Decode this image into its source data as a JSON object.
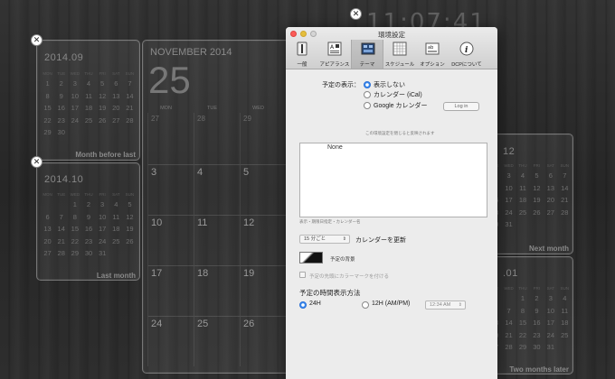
{
  "clock": {
    "time": "11:07:41"
  },
  "prev_month": {
    "title": "2014.09",
    "day_headers": [
      "MON",
      "TUE",
      "WED",
      "THU",
      "FRI",
      "SAT",
      "SUN"
    ],
    "days": [
      "1",
      "2",
      "3",
      "4",
      "5",
      "6",
      "7",
      "8",
      "9",
      "10",
      "11",
      "12",
      "13",
      "14",
      "15",
      "16",
      "17",
      "18",
      "19",
      "20",
      "21",
      "22",
      "23",
      "24",
      "25",
      "26",
      "27",
      "28",
      "29",
      "30"
    ],
    "footer": "Month before last"
  },
  "last_month": {
    "title": "2014.10",
    "day_headers": [
      "MON",
      "TUE",
      "WED",
      "THU",
      "FRI",
      "SAT",
      "SUN"
    ],
    "days": [
      "1",
      "2",
      "3",
      "4",
      "5",
      "6",
      "7",
      "8",
      "9",
      "10",
      "11",
      "12",
      "13",
      "14",
      "15",
      "16",
      "17",
      "18",
      "19",
      "20",
      "21",
      "22",
      "23",
      "24",
      "25",
      "26",
      "27",
      "28",
      "29",
      "30",
      "31"
    ],
    "footer": "Last month"
  },
  "main_calendar": {
    "month_label": "NOVEMBER 2014",
    "day": "25",
    "dow": [
      "MON",
      "TUE",
      "WED"
    ],
    "row1": [
      "27",
      "28",
      "29"
    ],
    "row2": [
      "3",
      "4",
      "5"
    ],
    "row3": [
      "10",
      "11",
      "12"
    ],
    "row4": [
      "17",
      "18",
      "19"
    ],
    "row5": [
      "24",
      "25",
      "26"
    ]
  },
  "next_month": {
    "title": "12",
    "day_headers": [
      "MON",
      "TUE",
      "WED",
      "THU",
      "FRI",
      "SAT",
      "SUN"
    ],
    "rows": [
      [
        "1",
        "2",
        "3",
        "4",
        "5",
        "6",
        "7"
      ],
      [
        "8",
        "9",
        "10",
        "11",
        "12",
        "13",
        "14"
      ],
      [
        "15",
        "16",
        "17",
        "18",
        "19",
        "20",
        "21"
      ],
      [
        "22",
        "23",
        "24",
        "25",
        "26",
        "27",
        "28"
      ],
      [
        "29",
        "30",
        "31",
        "",
        "",
        "",
        ""
      ]
    ],
    "footer": "Next month"
  },
  "two_months": {
    "title": ".01",
    "day_headers": [
      "MON",
      "TUE",
      "WED",
      "THU",
      "FRI",
      "SAT",
      "SUN"
    ],
    "rows": [
      [
        "",
        "",
        "",
        "1",
        "2",
        "3",
        "4"
      ],
      [
        "5",
        "6",
        "7",
        "8",
        "9",
        "10",
        "11"
      ],
      [
        "12",
        "13",
        "14",
        "15",
        "16",
        "17",
        "18"
      ],
      [
        "19",
        "20",
        "21",
        "22",
        "23",
        "24",
        "25"
      ],
      [
        "26",
        "27",
        "28",
        "29",
        "30",
        "31",
        ""
      ]
    ],
    "footer": "Two months later"
  },
  "dialog": {
    "title": "環境設定",
    "toolbar": [
      {
        "label": "一般",
        "icon": "switch-icon"
      },
      {
        "label": "アピアランス",
        "icon": "appearance-icon"
      },
      {
        "label": "テーマ",
        "icon": "theme-icon"
      },
      {
        "label": "スケジュール",
        "icon": "schedule-icon"
      },
      {
        "label": "オプション",
        "icon": "options-icon"
      },
      {
        "label": "DCPについて",
        "icon": "info-icon"
      }
    ],
    "schedule_display_label": "予定の表示：",
    "radio_none": "表示しない",
    "radio_ical": "カレンダー (iCal)",
    "radio_google": "Google カレンダー",
    "login_button": "Log in",
    "hint_text": "この環境設定を閉じると反映されます",
    "list_item": "None",
    "list_caption": "表示・期限日指定・カレンダー名",
    "interval_select": "15 分ごと",
    "update_label": "カレンダーを更新",
    "background_label": "予定の背景",
    "color_mark_label": "予定の先頭にカラーマークを付ける",
    "time_format_title": "予定の時間表示方法",
    "radio_24h": "24H",
    "radio_12h": "12H (AM/PM)",
    "time_example": "12:34 AM"
  }
}
